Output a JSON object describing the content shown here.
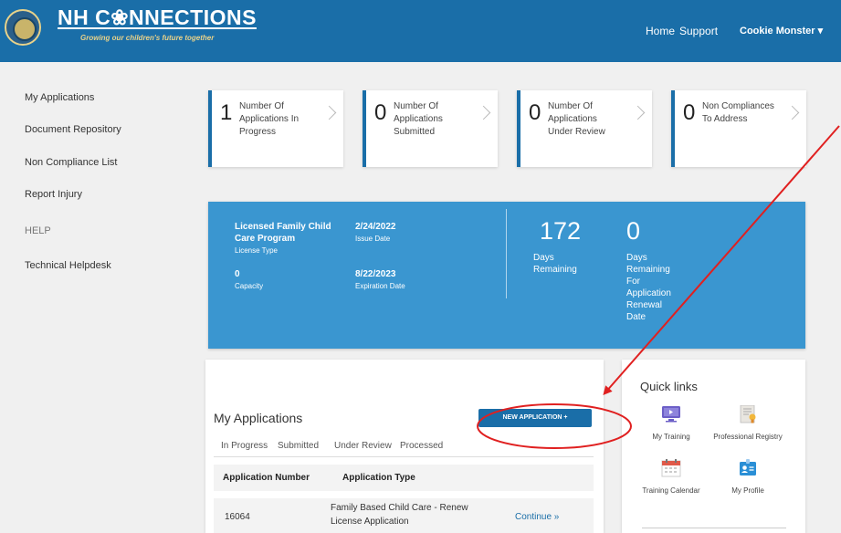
{
  "header": {
    "title": "NH C❀NNECTIONS",
    "tagline": "Growing our children's future together",
    "nav": {
      "home": "Home",
      "support": "Support",
      "user": "Cookie Monster ▾"
    }
  },
  "sidebar": {
    "items": [
      {
        "label": "My Applications"
      },
      {
        "label": "Document Repository"
      },
      {
        "label": "Non Compliance List"
      },
      {
        "label": "Report Injury"
      },
      {
        "label": "HELP"
      },
      {
        "label": "Technical Helpdesk"
      }
    ]
  },
  "stats": [
    {
      "count": "1",
      "label": "Number Of Applications In Progress"
    },
    {
      "count": "0",
      "label": "Number Of Applications Submitted"
    },
    {
      "count": "0",
      "label": "Number Of Applications Under Review"
    },
    {
      "count": "0",
      "label": "Non Compliances To Address"
    }
  ],
  "license": {
    "type_value": "Licensed Family Child Care Program",
    "type_label": "License Type",
    "capacity_value": "0",
    "capacity_label": "Capacity",
    "issue_date": "2/24/2022",
    "issue_label": "Issue Date",
    "expiration_date": "8/22/2023",
    "expiration_label": "Expiration Date",
    "days_remaining": "172",
    "days_remaining_label": "Days Remaining",
    "renewal_days": "0",
    "renewal_label": "Days Remaining For Application Renewal Date"
  },
  "applications": {
    "title": "My Applications",
    "new_button": "NEW APPLICATION  +",
    "tabs": [
      "In Progress",
      "Submitted",
      "Under Review",
      "Processed"
    ],
    "columns": [
      "Application Number",
      "Application Type"
    ],
    "rows": [
      {
        "number": "16064",
        "type": "Family Based Child Care - Renew License Application",
        "action": "Continue  »"
      }
    ]
  },
  "quick_links": {
    "title": "Quick links",
    "items": [
      {
        "label": "My Training",
        "icon": "monitor-icon"
      },
      {
        "label": "Professional Registry",
        "icon": "certificate-icon"
      },
      {
        "label": "Training Calendar",
        "icon": "calendar-icon"
      },
      {
        "label": "My Profile",
        "icon": "id-card-icon"
      }
    ]
  },
  "colors": {
    "header": "#1a6ea8",
    "license_panel": "#3a96d0",
    "annotation": "#e02020"
  }
}
